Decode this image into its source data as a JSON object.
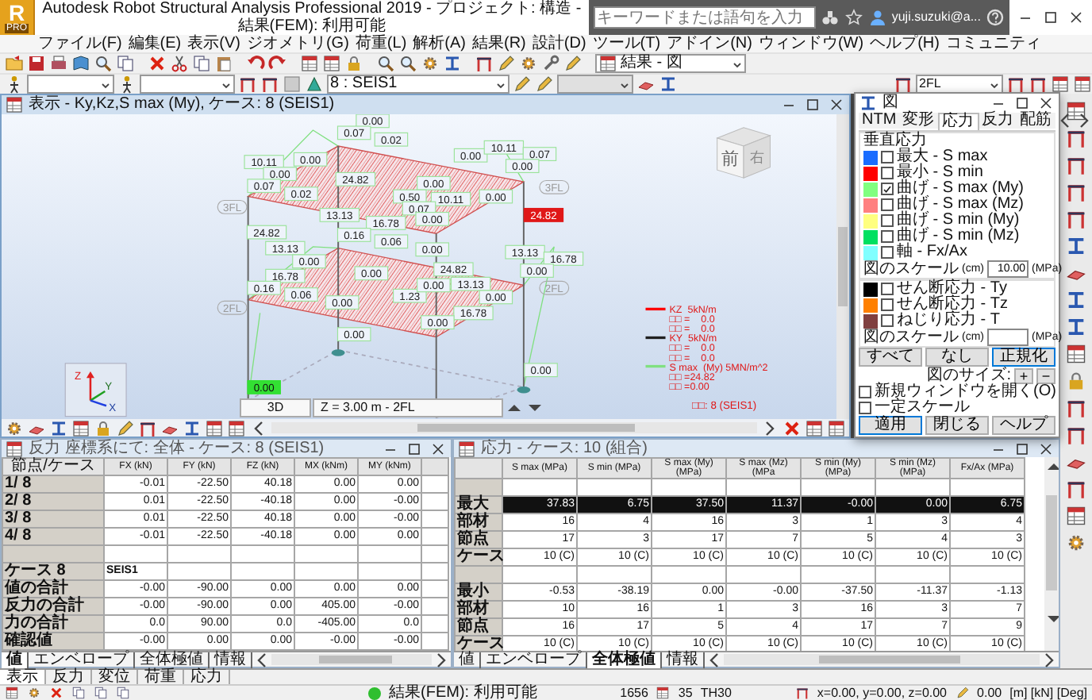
{
  "app": {
    "logo": "R",
    "logo_badge": "PRO",
    "title": "Autodesk Robot Structural Analysis Professional 2019 - プロジェクト: 構造 - 結果(FEM): 利用可能",
    "search": {
      "placeholder": "キーワードまたは語句を入力"
    },
    "user": "yuji.suzuki@a..."
  },
  "menu": [
    "ファイル(F)",
    "編集(E)",
    "表示(V)",
    "ジオメトリ(G)",
    "荷重(L)",
    "解析(A)",
    "結果(R)",
    "設計(D)",
    "ツール(T)",
    "アドイン(N)",
    "ウィンドウ(W)",
    "ヘルプ(H)",
    "コミュニティ"
  ],
  "toolbar": {
    "result_view": "結果 - 図",
    "case_select": "8 : SEIS1",
    "level_select": "2FL"
  },
  "viewport": {
    "title": "表示 - Ky,Kz,S max (My), ケース: 8 (SEIS1)",
    "labels": [
      {
        "text": "0.00",
        "kind": "value"
      },
      {
        "text": "0.07",
        "kind": "value"
      },
      {
        "text": "0.02",
        "kind": "value"
      },
      {
        "text": "10.11",
        "kind": "value"
      },
      {
        "text": "0.00",
        "kind": "value"
      },
      {
        "text": "0.00",
        "kind": "value"
      },
      {
        "text": "0.07",
        "kind": "value"
      },
      {
        "text": "24.82",
        "kind": "value"
      },
      {
        "text": "0.02",
        "kind": "value"
      },
      {
        "text": "0.00",
        "kind": "value"
      },
      {
        "text": "10.11",
        "kind": "value"
      },
      {
        "text": "0.07",
        "kind": "value"
      },
      {
        "text": "0.00",
        "kind": "value"
      },
      {
        "text": "0.00",
        "kind": "value"
      },
      {
        "text": "0.50",
        "kind": "value"
      },
      {
        "text": "10.11",
        "kind": "value"
      },
      {
        "text": "0.00",
        "kind": "value"
      },
      {
        "text": "0.07",
        "kind": "value"
      },
      {
        "text": "0.00",
        "kind": "value"
      },
      {
        "text": "13.13",
        "kind": "value"
      },
      {
        "text": "16.78",
        "kind": "value"
      },
      {
        "text": "0.16",
        "kind": "value"
      },
      {
        "text": "24.82",
        "kind": "value"
      },
      {
        "text": "0.06",
        "kind": "value"
      },
      {
        "text": "13.13",
        "kind": "value"
      },
      {
        "text": "0.00",
        "kind": "value"
      },
      {
        "text": "0.00",
        "kind": "value"
      },
      {
        "text": "16.78",
        "kind": "value"
      },
      {
        "text": "0.00",
        "kind": "value"
      },
      {
        "text": "24.82",
        "kind": "value"
      },
      {
        "text": "13.13",
        "kind": "value"
      },
      {
        "text": "16.78",
        "kind": "value"
      },
      {
        "text": "0.00",
        "kind": "value"
      },
      {
        "text": "0.16",
        "kind": "value"
      },
      {
        "text": "0.06",
        "kind": "value"
      },
      {
        "text": "0.00",
        "kind": "value"
      },
      {
        "text": "1.23",
        "kind": "value"
      },
      {
        "text": "0.00",
        "kind": "value"
      },
      {
        "text": "13.13",
        "kind": "value"
      },
      {
        "text": "0.00",
        "kind": "value"
      },
      {
        "text": "16.78",
        "kind": "value"
      },
      {
        "text": "0.00",
        "kind": "value"
      },
      {
        "text": "0.00",
        "kind": "value"
      },
      {
        "text": "0.00",
        "kind": "value"
      },
      {
        "text": "0.00",
        "kind": "min"
      },
      {
        "text": "24.82",
        "kind": "max"
      }
    ],
    "level_tags": [
      "3FL",
      "3FL",
      "2FL",
      "2FL"
    ],
    "cube_faces": [
      "前",
      "右"
    ],
    "axes": [
      "Z",
      "Y",
      "X"
    ],
    "legend": [
      {
        "text": "KZ  5kN/m",
        "color": "#ff0000"
      },
      {
        "text": "□□ =    0.0"
      },
      {
        "text": "□□ =    0.0"
      },
      {
        "text": "KY  5kN/m",
        "color": "#202020"
      },
      {
        "text": "□□ =    0.0"
      },
      {
        "text": "□□ =    0.0"
      },
      {
        "text": "S max  (My) 5MN/m^2",
        "color": "#80e080"
      },
      {
        "text": "□□ =24.82"
      },
      {
        "text": "□□ =0.00"
      }
    ],
    "case_note": "□□: 8 (SEIS1)",
    "view_mode": "3D",
    "level_field": "Z = 3.00 m - 2FL"
  },
  "dialog": {
    "title": "図",
    "tabs": [
      {
        "label": "NTM",
        "selected": false
      },
      {
        "label": "変形",
        "selected": false
      },
      {
        "label": "応力",
        "selected": true
      },
      {
        "label": "反力",
        "selected": false
      },
      {
        "label": "配筋",
        "selected": false
      }
    ],
    "group": "垂直応力",
    "normal_items": [
      {
        "label": "最大 - S max",
        "color": "#1a6cff",
        "checked": false
      },
      {
        "label": "最小 - S min",
        "color": "#ff0000",
        "checked": false
      },
      {
        "label": "曲げ - S max (My)",
        "color": "#80ff80",
        "checked": true
      },
      {
        "label": "曲げ - S max (Mz)",
        "color": "#ff8080",
        "checked": false
      },
      {
        "label": "曲げ - S min (My)",
        "color": "#ffff80",
        "checked": false
      },
      {
        "label": "曲げ - S min (Mz)",
        "color": "#00e060",
        "checked": false
      },
      {
        "label": "軸 - Fx/Ax",
        "color": "#80ffff",
        "checked": false
      }
    ],
    "scale1": {
      "label": "図のスケール",
      "unit_left": "(cm)",
      "value": "10.00",
      "unit_right": "(MPa)"
    },
    "shear_items": [
      {
        "label": "せん断応力 - Ty",
        "color": "#000000",
        "checked": false
      },
      {
        "label": "せん断応力 - Tz",
        "color": "#ff8000",
        "checked": false
      },
      {
        "label": "ねじり応力 - T",
        "color": "#804040",
        "checked": false
      }
    ],
    "scale2": {
      "label": "図のスケール",
      "unit_left": "(cm)",
      "unit_right": "(MPa)"
    },
    "buttons": [
      {
        "label": "すべて",
        "default": false
      },
      {
        "label": "なし",
        "default": false
      },
      {
        "label": "正規化",
        "default": true
      }
    ],
    "size_label": "図のサイズ:",
    "size_buttons": [
      "+",
      "−"
    ],
    "options": [
      {
        "label": "新規ウィンドウを開く(O)",
        "checked": false
      },
      {
        "label": "一定スケール",
        "checked": false
      }
    ],
    "actions": [
      {
        "label": "適用",
        "default": true
      },
      {
        "label": "閉じる",
        "default": false
      },
      {
        "label": "ヘルプ",
        "default": false
      }
    ]
  },
  "reactions": {
    "title": "反力 座標系にて: 全体 - ケース: 8 (SEIS1)",
    "columns": [
      "節点/ケース",
      "FX (kN)",
      "FY (kN)",
      "FZ (kN)",
      "MX (kNm)",
      "MY (kNm)"
    ],
    "rows": [
      {
        "kind": "data",
        "head": "1/ 8",
        "cells": [
          "-0.01",
          "-22.50",
          "40.18",
          "0.00",
          "0.00"
        ]
      },
      {
        "kind": "data",
        "head": "2/ 8",
        "cells": [
          "0.01",
          "-22.50",
          "-40.18",
          "0.00",
          "-0.00"
        ]
      },
      {
        "kind": "data",
        "head": "3/ 8",
        "cells": [
          "0.01",
          "-22.50",
          "40.18",
          "0.00",
          "-0.00"
        ]
      },
      {
        "kind": "data",
        "head": "4/ 8",
        "cells": [
          "-0.01",
          "-22.50",
          "-40.18",
          "0.00",
          "0.00"
        ]
      },
      {
        "kind": "spacer"
      },
      {
        "kind": "section",
        "head": "ケース 8",
        "cells": [
          "SEIS1"
        ]
      },
      {
        "kind": "data",
        "head": "値の合計",
        "cells": [
          "-0.00",
          "-90.00",
          "0.00",
          "0.00",
          "0.00"
        ]
      },
      {
        "kind": "data",
        "head": "反力の合計",
        "cells": [
          "-0.00",
          "-90.00",
          "0.00",
          "405.00",
          "-0.00"
        ]
      },
      {
        "kind": "data",
        "head": "力の合計",
        "cells": [
          "0.0",
          "90.00",
          "0.0",
          "-405.00",
          "0.0"
        ]
      },
      {
        "kind": "data",
        "head": "確認値",
        "cells": [
          "-0.00",
          "0.00",
          "0.00",
          "-0.00",
          "-0.00"
        ]
      }
    ],
    "tabs": [
      {
        "label": "値",
        "selected": true
      },
      {
        "label": "エンベロープ",
        "selected": false
      },
      {
        "label": "全体極値",
        "selected": false
      },
      {
        "label": "情報",
        "selected": false
      }
    ]
  },
  "stresses": {
    "title": "応力 - ケース: 10 (組合)",
    "columns": [
      "S max (MPa)",
      "S min (MPa)",
      "S max (My) (MPa)",
      "S max (Mz) (MPa",
      "S min (My) (MPa)",
      "S min (Mz) (MPa)",
      "Fx/Ax (MPa)"
    ],
    "rows": [
      {
        "kind": "spacer"
      },
      {
        "kind": "highlight",
        "head": "最大",
        "cells": [
          "37.83",
          "6.75",
          "37.50",
          "11.37",
          "-0.00",
          "0.00",
          "6.75"
        ]
      },
      {
        "kind": "data",
        "head": "部材",
        "cells": [
          "16",
          "4",
          "16",
          "3",
          "1",
          "3",
          "4"
        ]
      },
      {
        "kind": "data",
        "head": "節点",
        "cells": [
          "17",
          "3",
          "17",
          "7",
          "5",
          "4",
          "3"
        ]
      },
      {
        "kind": "data",
        "head": "ケース",
        "cells": [
          "10 (C)",
          "10 (C)",
          "10 (C)",
          "10 (C)",
          "10 (C)",
          "10 (C)",
          "10 (C)"
        ]
      },
      {
        "kind": "spacer"
      },
      {
        "kind": "data",
        "head": "最小",
        "cells": [
          "-0.53",
          "-38.19",
          "0.00",
          "-0.00",
          "-37.50",
          "-11.37",
          "-1.13"
        ]
      },
      {
        "kind": "data",
        "head": "部材",
        "cells": [
          "10",
          "16",
          "1",
          "3",
          "16",
          "3",
          "7"
        ]
      },
      {
        "kind": "data",
        "head": "節点",
        "cells": [
          "16",
          "17",
          "5",
          "4",
          "17",
          "7",
          "9"
        ]
      },
      {
        "kind": "data",
        "head": "ケース",
        "cells": [
          "10 (C)",
          "10 (C)",
          "10 (C)",
          "10 (C)",
          "10 (C)",
          "10 (C)",
          "10 (C)"
        ]
      }
    ],
    "tabs": [
      {
        "label": "値",
        "selected": false
      },
      {
        "label": "エンベロープ",
        "selected": false
      },
      {
        "label": "全体極値",
        "selected": true
      },
      {
        "label": "情報",
        "selected": false
      }
    ]
  },
  "bottom_tabs": [
    {
      "label": "表示",
      "selected": true
    },
    {
      "label": "反力",
      "selected": false
    },
    {
      "label": "変位",
      "selected": false
    },
    {
      "label": "荷重",
      "selected": false
    },
    {
      "label": "応力",
      "selected": false
    }
  ],
  "status": {
    "message": "結果(FEM): 利用可能",
    "nodes": "1656",
    "count": "35",
    "section": "TH30",
    "coords": "x=0.00, y=0.00, z=0.00",
    "angle": "0.00",
    "units": "[m] [kN] [Deg]"
  }
}
